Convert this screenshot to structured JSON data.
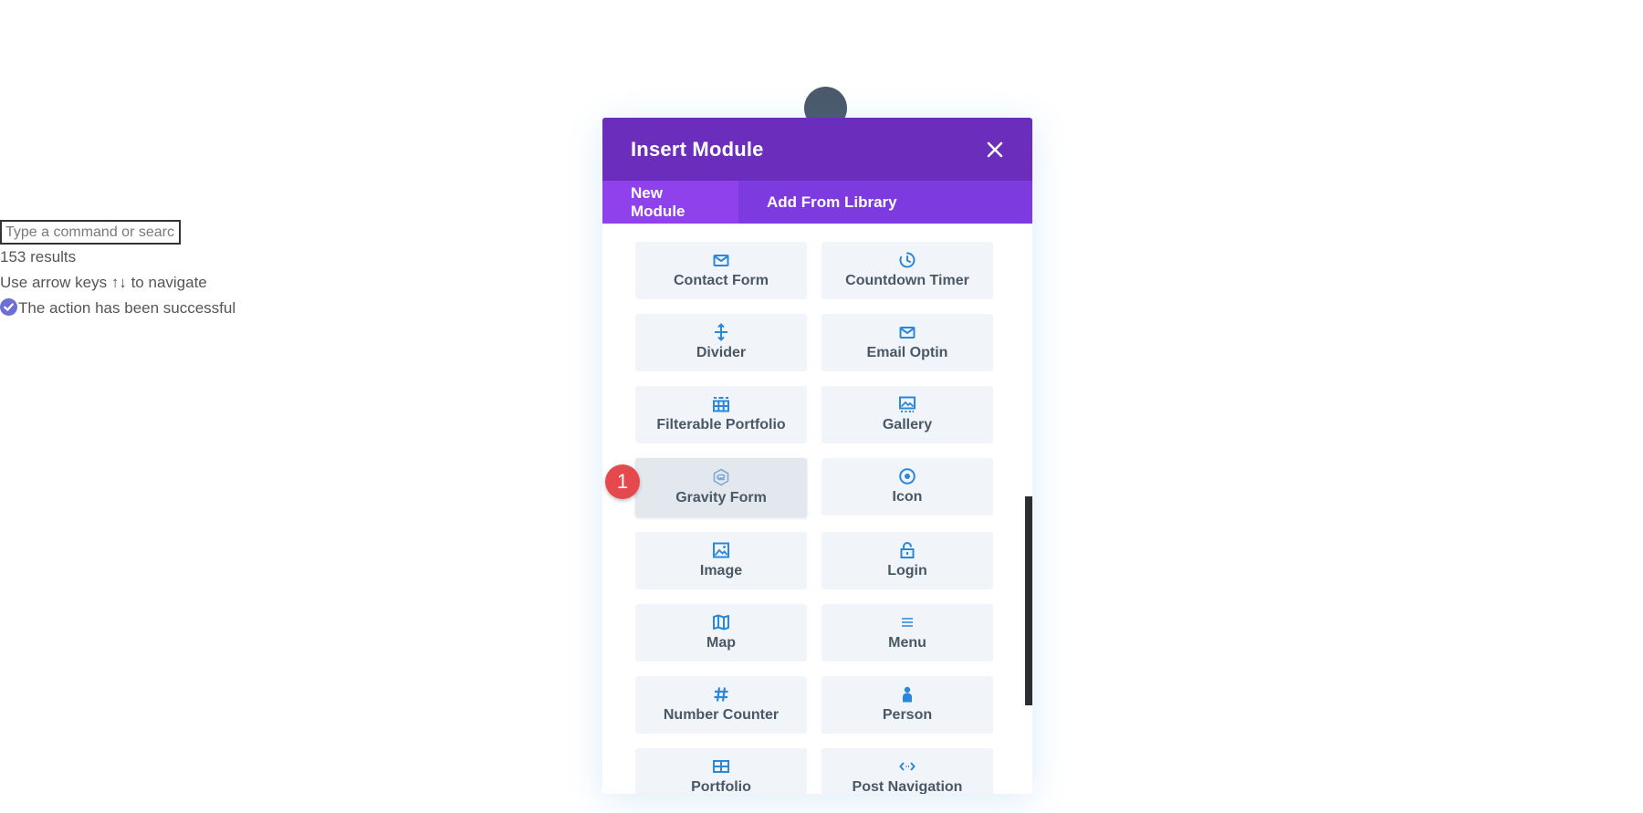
{
  "command_palette": {
    "placeholder": "Type a command or search",
    "results": "153 results",
    "hint": "Use arrow keys ↑↓ to navigate",
    "success": "The action has been successful"
  },
  "modal": {
    "title": "Insert Module",
    "tabs": [
      {
        "label": "New Module",
        "active": true
      },
      {
        "label": "Add From Library",
        "active": false
      }
    ],
    "modules": [
      {
        "label": "Contact Form",
        "icon": "envelope-icon"
      },
      {
        "label": "Countdown Timer",
        "icon": "timer-icon"
      },
      {
        "label": "Divider",
        "icon": "divider-icon"
      },
      {
        "label": "Email Optin",
        "icon": "envelope-icon"
      },
      {
        "label": "Filterable Portfolio",
        "icon": "filterable-grid-icon"
      },
      {
        "label": "Gallery",
        "icon": "gallery-icon"
      },
      {
        "label": "Gravity Form",
        "icon": "gravity-forms-icon"
      },
      {
        "label": "Icon",
        "icon": "star-circle-icon"
      },
      {
        "label": "Image",
        "icon": "image-icon"
      },
      {
        "label": "Login",
        "icon": "unlock-icon"
      },
      {
        "label": "Map",
        "icon": "map-icon"
      },
      {
        "label": "Menu",
        "icon": "menu-icon"
      },
      {
        "label": "Number Counter",
        "icon": "hash-icon"
      },
      {
        "label": "Person",
        "icon": "person-icon"
      },
      {
        "label": "Portfolio",
        "icon": "grid-icon"
      },
      {
        "label": "Post Navigation",
        "icon": "post-navigation-icon"
      }
    ]
  },
  "step_badge": "1",
  "colors": {
    "header": "#6b2dbb",
    "tabs": "#7d3bdf",
    "active_tab": "#8f42ec",
    "icon_blue": "#2b87da",
    "badge": "#e5484d"
  }
}
